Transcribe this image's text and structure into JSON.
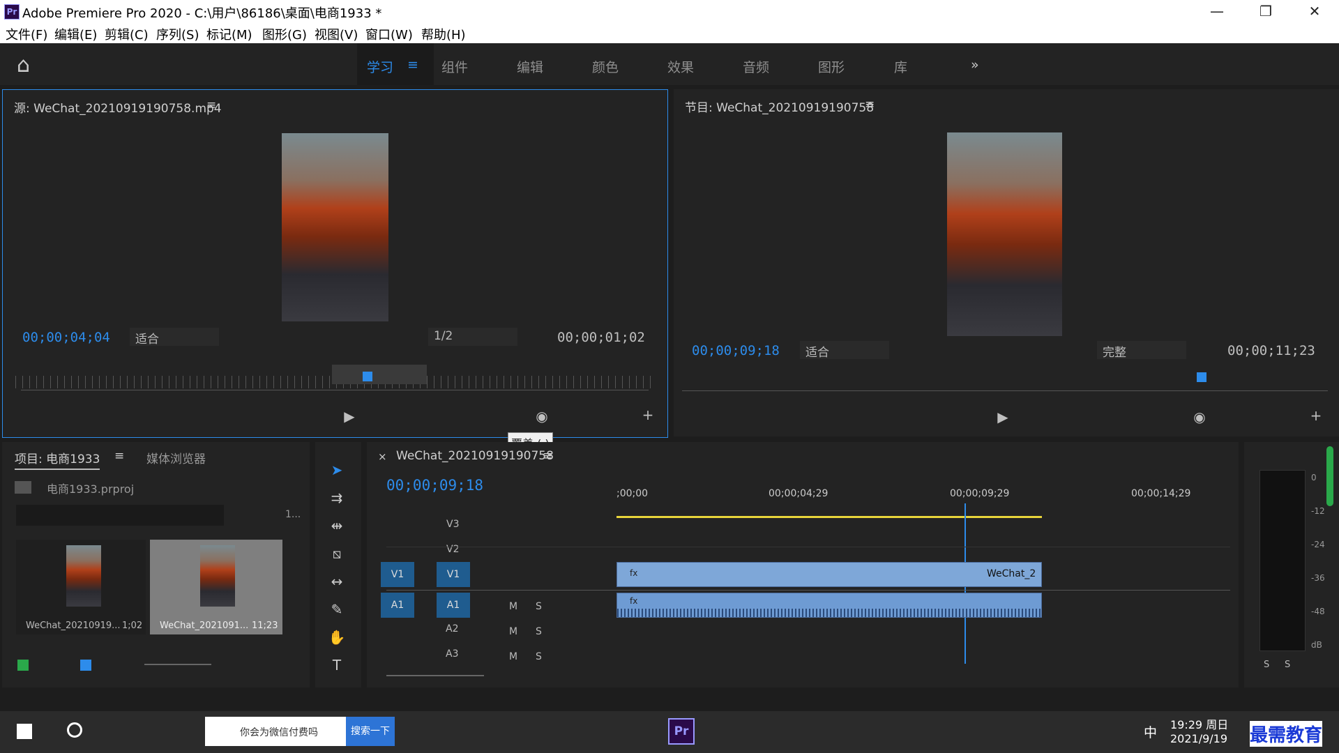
{
  "window": {
    "title": "Adobe Premiere Pro 2020 - C:\\用户\\86186\\桌面\\电商1933 *",
    "logo": "Pr",
    "min": "—",
    "restore": "❐",
    "close": "✕"
  },
  "menu": [
    "文件(F)",
    "编辑(E)",
    "剪辑(C)",
    "序列(S)",
    "标记(M)",
    "图形(G)",
    "视图(V)",
    "窗口(W)",
    "帮助(H)"
  ],
  "workspaces": {
    "tabs": [
      "学习",
      "组件",
      "编辑",
      "颜色",
      "效果",
      "音频",
      "图形",
      "库"
    ],
    "active": "学习",
    "more": "»"
  },
  "source": {
    "title": "源: WeChat_20210919190758.mp4",
    "menu": "≡",
    "timecode": "00;00;04;04",
    "zoom": "适合",
    "resolution": "1/2",
    "duration": "00;00;01;02"
  },
  "program": {
    "title": "节目: WeChat_20210919190758",
    "menu": "≡",
    "timecode": "00;00;09;18",
    "zoom": "适合",
    "quality": "完整",
    "duration": "00;00;11;23"
  },
  "tooltip": "覆盖 (.)",
  "project": {
    "tab": "项目: 电商1933",
    "tab_menu": "≡",
    "tab2": "媒体浏览器",
    "file": "电商1933.prproj",
    "count": "1...",
    "items": [
      {
        "name": "WeChat_20210919...",
        "duration": "1;02"
      },
      {
        "name": "WeChat_2021091...",
        "duration": "11;23"
      }
    ]
  },
  "timeline": {
    "close": "×",
    "tab": "WeChat_20210919190758",
    "tab_menu": "≡",
    "timecode": "00;00;09;18",
    "ruler": [
      ";00;00",
      "00;00;04;29",
      "00;00;09;29",
      "00;00;14;29"
    ],
    "tracks": [
      {
        "src": "",
        "name": "V3",
        "kind": "video"
      },
      {
        "src": "",
        "name": "V2",
        "kind": "video"
      },
      {
        "src": "V1",
        "name": "V1",
        "kind": "video"
      },
      {
        "src": "A1",
        "name": "A1",
        "kind": "audio"
      },
      {
        "src": "",
        "name": "A2",
        "kind": "audio"
      },
      {
        "src": "",
        "name": "A3",
        "kind": "audio"
      }
    ],
    "clip_label": "WeChat_2",
    "fx": "fx",
    "mute": "M",
    "solo": "S"
  },
  "meter": {
    "labels": [
      "0",
      "-12",
      "-24",
      "-36",
      "-48",
      "dB"
    ],
    "solo": [
      "S",
      "S"
    ]
  },
  "taskbar": {
    "search_text": "你会为微信付费吗",
    "search_btn": "搜索一下",
    "time": "19:29 周日",
    "date": "2021/9/19",
    "ime": "中",
    "watermark": "最需教育"
  },
  "icons": {
    "home": "⌂",
    "play": "▶",
    "camera": "◉",
    "add": "+"
  }
}
